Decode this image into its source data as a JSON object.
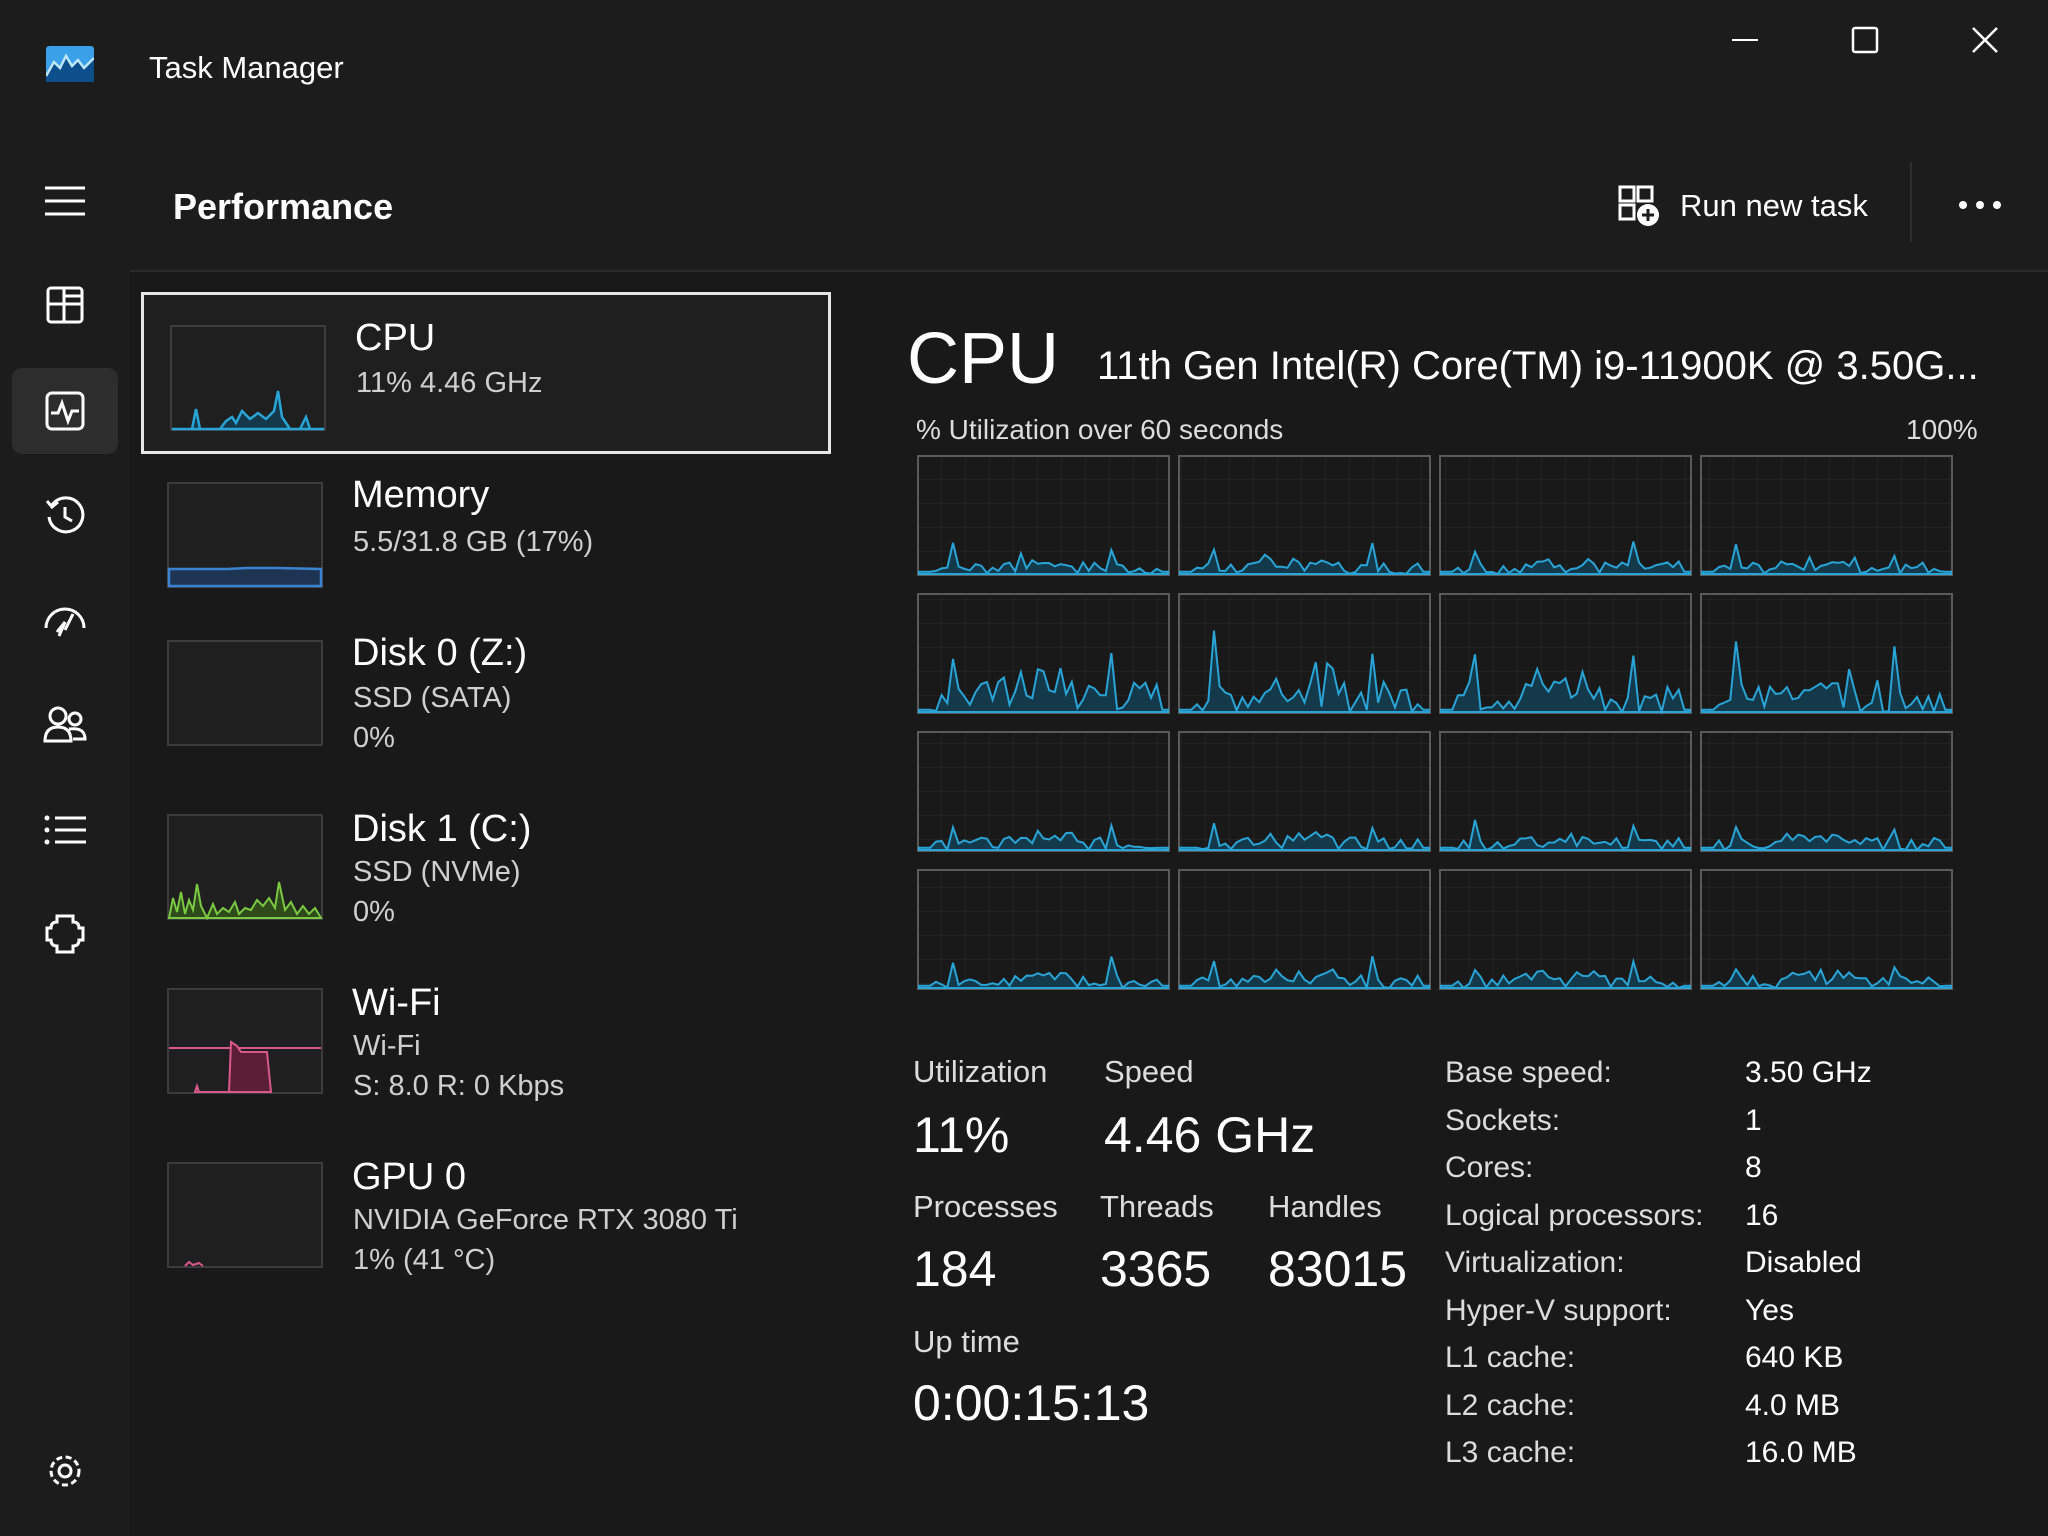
{
  "window": {
    "title": "Task Manager"
  },
  "rail": {
    "items": [
      "menu-icon",
      "processes-icon",
      "performance-icon",
      "app-history-icon",
      "startup-apps-icon",
      "users-icon",
      "details-icon",
      "services-icon",
      "settings-icon"
    ],
    "active": "performance-icon"
  },
  "header": {
    "title": "Performance",
    "run_new_task": "Run new task"
  },
  "devices": [
    {
      "name": "CPU",
      "line1": "11%  4.46 GHz",
      "line2": "",
      "color": "#29a4d6"
    },
    {
      "name": "Memory",
      "line1": "5.5/31.8 GB (17%)",
      "line2": "",
      "color": "#3b82d0"
    },
    {
      "name": "Disk 0 (Z:)",
      "line1": "SSD (SATA)",
      "line2": "0%",
      "color": "#6bb84a"
    },
    {
      "name": "Disk 1 (C:)",
      "line1": "SSD (NVMe)",
      "line2": "0%",
      "color": "#6bb84a"
    },
    {
      "name": "Wi-Fi",
      "line1": "Wi-Fi",
      "line2": "S: 8.0  R: 0 Kbps",
      "color": "#d9588b"
    },
    {
      "name": "GPU 0",
      "line1": "NVIDIA GeForce RTX 3080 Ti",
      "line2": "1%  (41 °C)",
      "color": "#d9588b"
    }
  ],
  "detail": {
    "title": "CPU",
    "model": "11th Gen Intel(R) Core(TM) i9-11900K @ 3.50G...",
    "graph_label": "% Utilization over 60 seconds",
    "graph_max": "100%",
    "stats": {
      "utilization_label": "Utilization",
      "utilization": "11%",
      "speed_label": "Speed",
      "speed": "4.46 GHz",
      "processes_label": "Processes",
      "processes": "184",
      "threads_label": "Threads",
      "threads": "3365",
      "handles_label": "Handles",
      "handles": "83015",
      "uptime_label": "Up time",
      "uptime": "0:00:15:13"
    },
    "specs": [
      {
        "label": "Base speed:",
        "value": "3.50 GHz"
      },
      {
        "label": "Sockets:",
        "value": "1"
      },
      {
        "label": "Cores:",
        "value": "8"
      },
      {
        "label": "Logical processors:",
        "value": "16"
      },
      {
        "label": "Virtualization:",
        "value": "Disabled"
      },
      {
        "label": "Hyper-V support:",
        "value": "Yes"
      },
      {
        "label": "L1 cache:",
        "value": "640 KB"
      },
      {
        "label": "L2 cache:",
        "value": "4.0 MB"
      },
      {
        "label": "L3 cache:",
        "value": "16.0 MB"
      }
    ]
  },
  "colors": {
    "cpu_line": "#29a4d6",
    "cpu_fill": "#14394a",
    "disk_line": "#7ac943",
    "wifi_line": "#d9588b"
  }
}
